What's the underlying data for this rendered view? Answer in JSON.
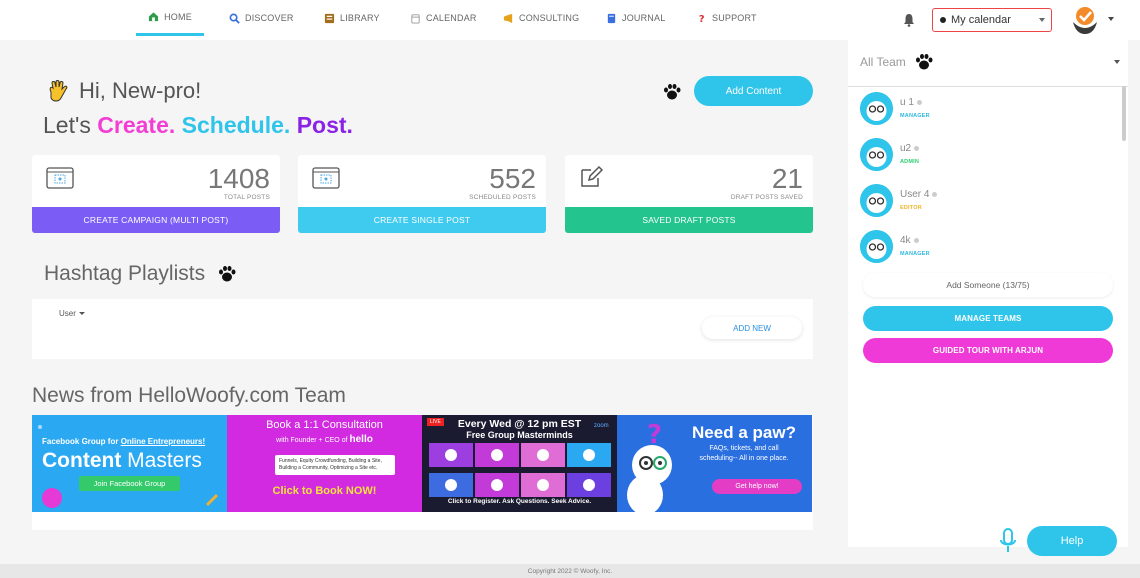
{
  "nav": {
    "items": [
      {
        "label": "HOME",
        "icon": "home-icon",
        "color": "#2e9c4b"
      },
      {
        "label": "DISCOVER",
        "icon": "magnifier-icon",
        "color": "#3a6fe0"
      },
      {
        "label": "LIBRARY",
        "icon": "library-icon",
        "color": "#a36d20"
      },
      {
        "label": "CALENDAR",
        "icon": "calendar-icon",
        "color": "#999999"
      },
      {
        "label": "CONSULTING",
        "icon": "megaphone-icon",
        "color": "#e6a31a"
      },
      {
        "label": "JOURNAL",
        "icon": "journal-icon",
        "color": "#3a6fe0"
      },
      {
        "label": "SUPPORT",
        "icon": "question-icon",
        "color": "#d33"
      }
    ],
    "calendar_select": "My calendar"
  },
  "main": {
    "greeting": "Hi, New-pro!",
    "headline": {
      "lead": "Let's",
      "w1": "Create.",
      "w2": "Schedule.",
      "w3": "Post."
    },
    "add_content": "Add Content",
    "stats": [
      {
        "number": "1408",
        "label": "TOTAL POSTS",
        "action": "CREATE CAMPAIGN (MULTI POST)",
        "color": "#7b5cf5"
      },
      {
        "number": "552",
        "label": "SCHEDULED POSTS",
        "action": "CREATE SINGLE POST",
        "color": "#3fcbef"
      },
      {
        "number": "21",
        "label": "DRAFT POSTS SAVED",
        "action": "SAVED DRAFT POSTS",
        "color": "#24c48e"
      }
    ],
    "hashtag_title": "Hashtag Playlists",
    "hashtag_user": "User",
    "add_new": "ADD NEW",
    "news_title": "News from HelloWoofy.com Team",
    "banners": {
      "b1": {
        "line1": "Facebook Group for",
        "line1b": "Online Entrepreneurs!",
        "big1": "Content",
        "big2": "Masters",
        "btn": "Join Facebook Group"
      },
      "b2": {
        "title": "Book a 1:1 Consultation",
        "sub": "with Founder + CEO of",
        "brand": "hello",
        "l1": "Funnels, Equity Crowdfunding, Building a Site,",
        "l2": "Building a Community, Optimizing a Site etc.",
        "cta": "Click to Book NOW!"
      },
      "b3": {
        "live": "LIVE",
        "t1": "Every Wed @ 12 pm EST",
        "t2": "Free Group Masterminds",
        "zoom": "zoom",
        "cta": "Click to Register. Ask Questions. Seek Advice."
      },
      "b4": {
        "title": "Need a paw?",
        "l1": "FAQs, tickets, and call",
        "l2": "scheduling-- All in one place.",
        "btn": "Get help now!"
      }
    }
  },
  "side": {
    "team_select": "All Team",
    "members": [
      {
        "name": "u 1",
        "role": "MANAGER",
        "role_color": "#2fb8e0"
      },
      {
        "name": "u2",
        "role": "ADMIN",
        "role_color": "#2ecc71"
      },
      {
        "name": "User 4",
        "role": "EDITOR",
        "role_color": "#f0b429"
      },
      {
        "name": "4k",
        "role": "MANAGER",
        "role_color": "#2fb8e0"
      }
    ],
    "add_someone": "Add Someone (13/75)",
    "manage_teams": "MANAGE TEAMS",
    "guided_tour": "GUIDED TOUR WITH ARJUN"
  },
  "help": "Help",
  "footer": "Copyright 2022 © Woofy, Inc."
}
